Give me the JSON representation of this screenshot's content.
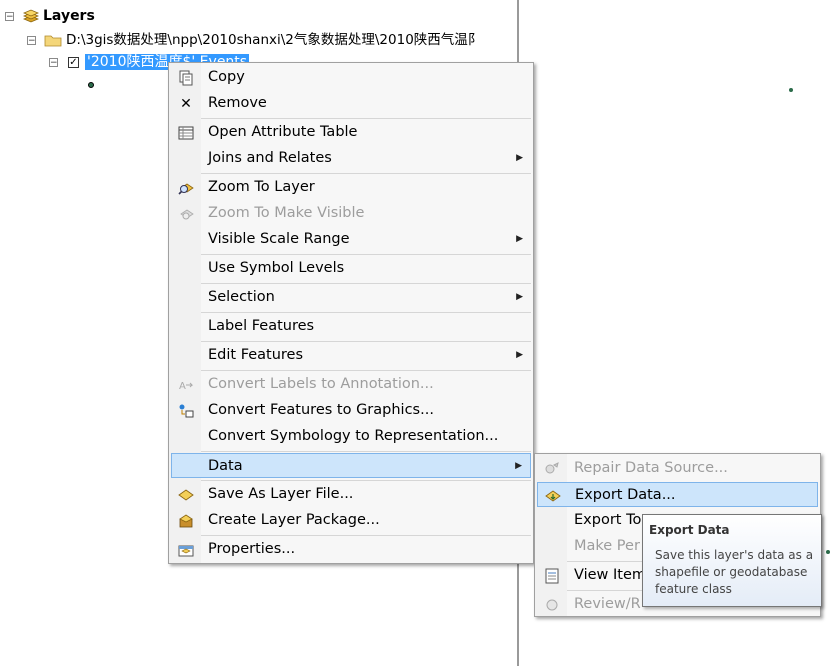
{
  "toc": {
    "root_label": "Layers",
    "folder_path": "D:\\3gis数据处理\\npp\\2010shanxi\\2气象数据处理\\2010陕西气温阝",
    "layer_name": "'2010陕西温度$' Events"
  },
  "context_menu": {
    "items": [
      {
        "label": "Copy",
        "icon": "copy-icon",
        "enabled": true
      },
      {
        "label": "Remove",
        "icon": "remove-x-icon",
        "enabled": true
      },
      {
        "label": "Open Attribute Table",
        "icon": "table-icon",
        "enabled": true
      },
      {
        "label": "Joins and Relates",
        "icon": "",
        "enabled": true,
        "submenu": true
      },
      {
        "label": "Zoom To Layer",
        "icon": "zoom-layer-icon",
        "enabled": true
      },
      {
        "label": "Zoom To Make Visible",
        "icon": "zoom-visible-icon",
        "enabled": false
      },
      {
        "label": "Visible Scale Range",
        "icon": "",
        "enabled": true,
        "submenu": true
      },
      {
        "label": "Use Symbol Levels",
        "icon": "",
        "enabled": true
      },
      {
        "label": "Selection",
        "icon": "",
        "enabled": true,
        "submenu": true
      },
      {
        "label": "Label Features",
        "icon": "",
        "enabled": true
      },
      {
        "label": "Edit Features",
        "icon": "",
        "enabled": true,
        "submenu": true
      },
      {
        "label": "Convert Labels to Annotation...",
        "icon": "convert-labels-icon",
        "enabled": false
      },
      {
        "label": "Convert Features to Graphics...",
        "icon": "convert-features-icon",
        "enabled": true
      },
      {
        "label": "Convert Symbology to Representation...",
        "icon": "",
        "enabled": true
      },
      {
        "label": "Data",
        "icon": "",
        "enabled": true,
        "submenu": true,
        "highlighted": true
      },
      {
        "label": "Save As Layer File...",
        "icon": "layer-file-icon",
        "enabled": true
      },
      {
        "label": "Create Layer Package...",
        "icon": "layer-package-icon",
        "enabled": true
      },
      {
        "label": "Properties...",
        "icon": "properties-icon",
        "enabled": true
      }
    ]
  },
  "data_submenu": {
    "items": [
      {
        "label": "Repair Data Source...",
        "icon": "repair-icon",
        "enabled": false
      },
      {
        "label": "Export Data...",
        "icon": "export-data-icon",
        "enabled": true,
        "highlighted": true
      },
      {
        "label": "Export To",
        "icon": "",
        "enabled": true
      },
      {
        "label": "Make Per",
        "icon": "",
        "enabled": false
      },
      {
        "label": "View Item",
        "icon": "view-item-icon",
        "enabled": true
      },
      {
        "label": "Review/R",
        "icon": "review-icon",
        "enabled": false
      }
    ]
  },
  "tooltip": {
    "title": "Export Data",
    "description": "Save this layer's data as a shapefile or geodatabase feature class"
  },
  "colors": {
    "selection_blue": "#3399ff",
    "menu_highlight": "#cde5fb",
    "menu_highlight_border": "#7eb4ea",
    "point_symbol": "#2b6b4a"
  }
}
